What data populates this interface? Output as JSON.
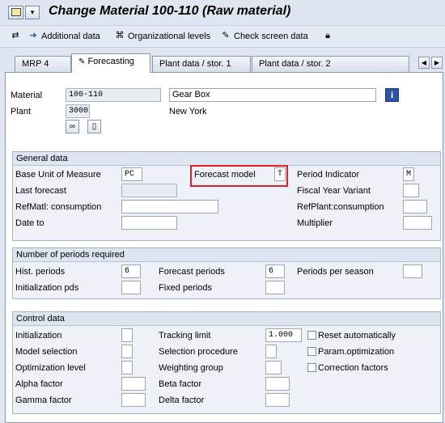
{
  "title": "Change Material 100-110 (Raw material)",
  "toolbar": {
    "additional_data": "Additional data",
    "org_levels": "Organizational levels",
    "check_screen": "Check screen data"
  },
  "tabs": [
    "MRP 4",
    "Forecasting",
    "Plant data / stor. 1",
    "Plant data / stor. 2"
  ],
  "header": {
    "material_label": "Material",
    "material_value": "100-110",
    "material_desc": "Gear Box",
    "plant_label": "Plant",
    "plant_value": "3000",
    "plant_name": "New York"
  },
  "general": {
    "title": "General data",
    "base_uom_label": "Base Unit of Measure",
    "base_uom_value": "PC",
    "forecast_model_label": "Forecast model",
    "forecast_model_value": "T",
    "period_indicator_label": "Period Indicator",
    "period_indicator_value": "M",
    "last_forecast_label": "Last forecast",
    "fiscal_year_label": "Fiscal Year Variant",
    "refmatl_label": "RefMatl: consumption",
    "refplant_label": "RefPlant:consumption",
    "date_to_label": "Date to",
    "multiplier_label": "Multiplier"
  },
  "periods": {
    "title": "Number of periods required",
    "hist_label": "Hist. periods",
    "hist_value": "6",
    "forecast_periods_label": "Forecast periods",
    "forecast_periods_value": "6",
    "periods_per_season_label": "Periods per season",
    "init_pds_label": "Initialization pds",
    "fixed_periods_label": "Fixed periods"
  },
  "control": {
    "title": "Control data",
    "initialization_label": "Initialization",
    "tracking_limit_label": "Tracking limit",
    "tracking_limit_value": "1.000",
    "reset_auto_label": "Reset automatically",
    "model_selection_label": "Model selection",
    "selection_procedure_label": "Selection procedure",
    "param_opt_label": "Param.optimization",
    "opt_level_label": "Optimization level",
    "weighting_group_label": "Weighting group",
    "correction_factors_label": "Correction factors",
    "alpha_label": "Alpha factor",
    "beta_label": "Beta factor",
    "gamma_label": "Gamma factor",
    "delta_label": "Delta factor"
  },
  "icons": {
    "accent": "#2b53a8",
    "highlight": "#e02020"
  }
}
